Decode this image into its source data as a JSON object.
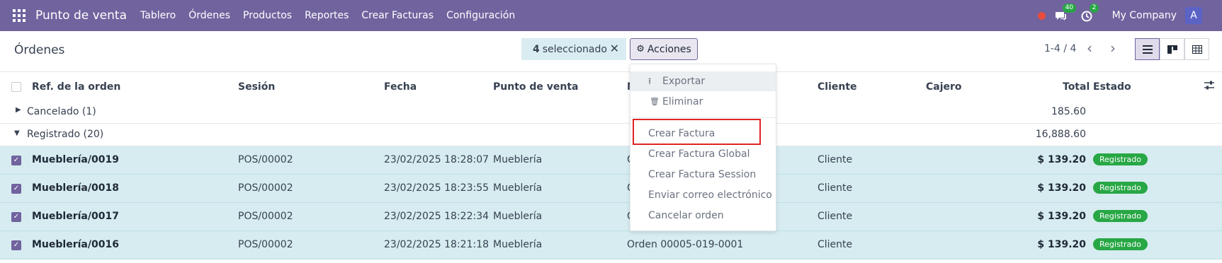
{
  "navbar": {
    "app_name": "Punto de venta",
    "menu": [
      "Tablero",
      "Órdenes",
      "Productos",
      "Reportes",
      "Crear Facturas",
      "Configuración"
    ],
    "messages_count": "40",
    "activities_count": "2",
    "company": "My Company",
    "avatar_letter": "A"
  },
  "control": {
    "title": "Órdenes",
    "selected_count": "4",
    "selected_text": "seleccionado",
    "actions_label": "Acciones",
    "pager": "1-4 / 4"
  },
  "table": {
    "headers": {
      "ref": "Ref. de la orden",
      "session": "Sesión",
      "date": "Fecha",
      "pos": "Punto de venta",
      "number_partial": "N",
      "customer": "Cliente",
      "cashier": "Cajero",
      "total": "Total",
      "status": "Estado"
    },
    "groups": [
      {
        "label": "Cancelado (1)",
        "total": "185.60",
        "expanded": false
      },
      {
        "label": "Registrado (20)",
        "total": "16,888.60",
        "expanded": true
      }
    ],
    "rows": [
      {
        "ref": "Mueblería/0019",
        "session": "POS/00002",
        "date": "23/02/2025 18:28:07",
        "pos": "Mueblería",
        "number": "C",
        "customer": "Cliente",
        "total": "$ 139.20",
        "status": "Registrado"
      },
      {
        "ref": "Mueblería/0018",
        "session": "POS/00002",
        "date": "23/02/2025 18:23:55",
        "pos": "Mueblería",
        "number": "C",
        "customer": "Cliente",
        "total": "$ 139.20",
        "status": "Registrado"
      },
      {
        "ref": "Mueblería/0017",
        "session": "POS/00002",
        "date": "23/02/2025 18:22:34",
        "pos": "Mueblería",
        "number": "C",
        "customer": "Cliente",
        "total": "$ 139.20",
        "status": "Registrado"
      },
      {
        "ref": "Mueblería/0016",
        "session": "POS/00002",
        "date": "23/02/2025 18:21:18",
        "pos": "Mueblería",
        "number": "Orden 00005-019-0001",
        "customer": "Cliente",
        "total": "$ 139.20",
        "status": "Registrado"
      }
    ]
  },
  "dropdown": {
    "items": [
      "Exportar",
      "Eliminar",
      "Crear Factura",
      "Crear Factura Global",
      "Crear Factura Session",
      "Enviar correo electrónico",
      "Cancelar orden"
    ]
  },
  "colors": {
    "navbar": "#71639e",
    "selected_row": "#d6ecf0",
    "status_badge": "#28a745",
    "highlight": "#e02424"
  }
}
